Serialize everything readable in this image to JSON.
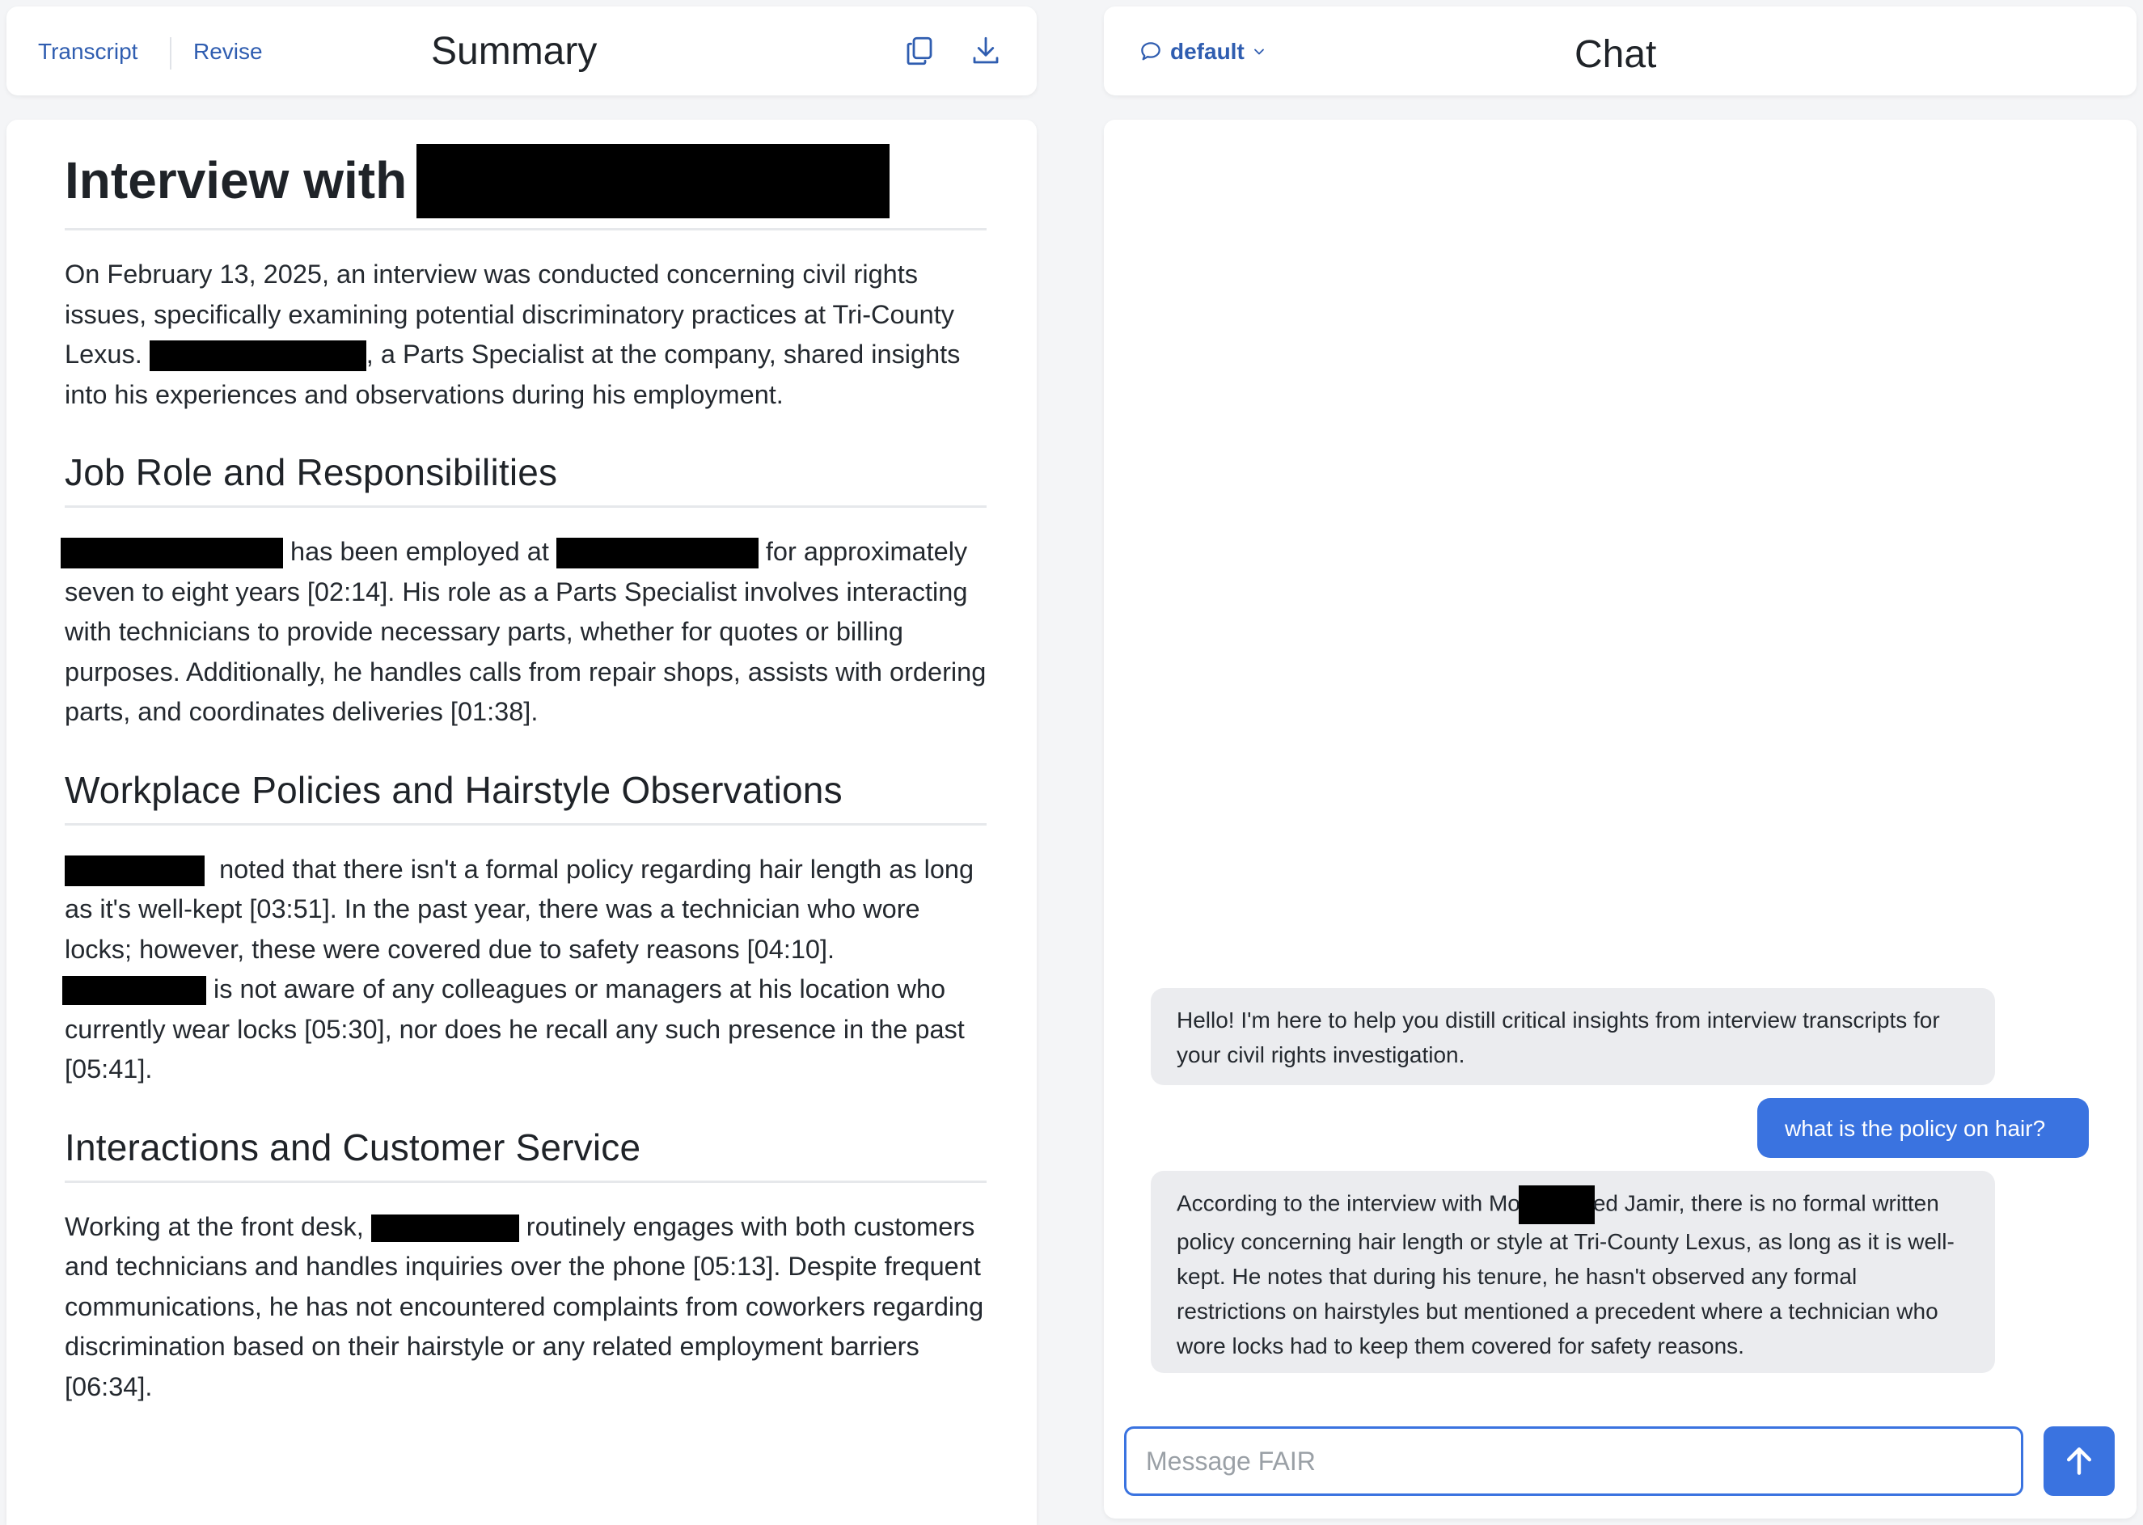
{
  "summary_header": {
    "transcript_label": "Transcript",
    "revise_label": "Revise",
    "title": "Summary",
    "copy_icon": "copy-icon",
    "download_icon": "download-icon"
  },
  "document": {
    "title": "Interview with",
    "intro": {
      "before": "On February 13, 2025, an interview was conducted concerning civil rights issues, specifically examining potential discriminatory practices at Tri-County Lexus.",
      "after": ", a Parts Specialist at the company, shared insights into his experiences and observations during his employment."
    },
    "sections": [
      {
        "heading": "Job Role and Responsibilities",
        "p1_a": "has been employed at",
        "p1_b": "for approximately seven to eight years [02:14]. His role as a Parts Specialist involves interacting with technicians to provide necessary parts, whether for quotes or billing purposes. Additionally, he handles calls from repair shops, assists with ordering parts, and coordinates deliveries [01:38]."
      },
      {
        "heading": "Workplace Policies and Hairstyle Observations",
        "p1": "noted that there isn't a formal policy regarding hair length as long as it's well-kept [03:51]. In the past year, there was a technician who wore locks; however, these were covered due to safety reasons [04:10].",
        "p2": "is not aware of any colleagues or managers at his location who currently wear locks [05:30], nor does he recall any such presence in the past [05:41]."
      },
      {
        "heading": "Interactions and Customer Service",
        "p1_a": "Working at the front desk,",
        "p1_b": "routinely engages with both customers and technicians and handles inquiries over the phone [05:13]. Despite frequent communications, he has not encountered complaints from coworkers regarding discrimination based on their hairstyle or any related employment barriers [06:34]."
      }
    ]
  },
  "chat_header": {
    "model_label": "default",
    "title": "Chat",
    "chat_icon": "chat-bubble-icon",
    "chevron_icon": "chevron-down-icon"
  },
  "chat": {
    "messages": [
      {
        "role": "bot",
        "text": "Hello! I'm here to help you distill critical insights from interview transcripts for your civil rights investigation."
      },
      {
        "role": "user",
        "text": "what is the policy on hair?"
      },
      {
        "role": "bot",
        "text_before": "According to the interview with Mo",
        "text_after": "ed Jamir, there is no formal written policy concerning hair length or style at Tri-County Lexus, as long as it is well-kept. He notes that during his tenure, he hasn't observed any formal restrictions on hairstyles but mentioned a precedent where a technician who wore locks had to keep them covered for safety reasons."
      }
    ],
    "input_placeholder": "Message FAIR",
    "send_icon": "arrow-up-icon"
  },
  "colors": {
    "accent": "#3a73e0",
    "link": "#2f5db0",
    "bot_bubble": "#ebecef",
    "background": "#f4f5f7"
  }
}
